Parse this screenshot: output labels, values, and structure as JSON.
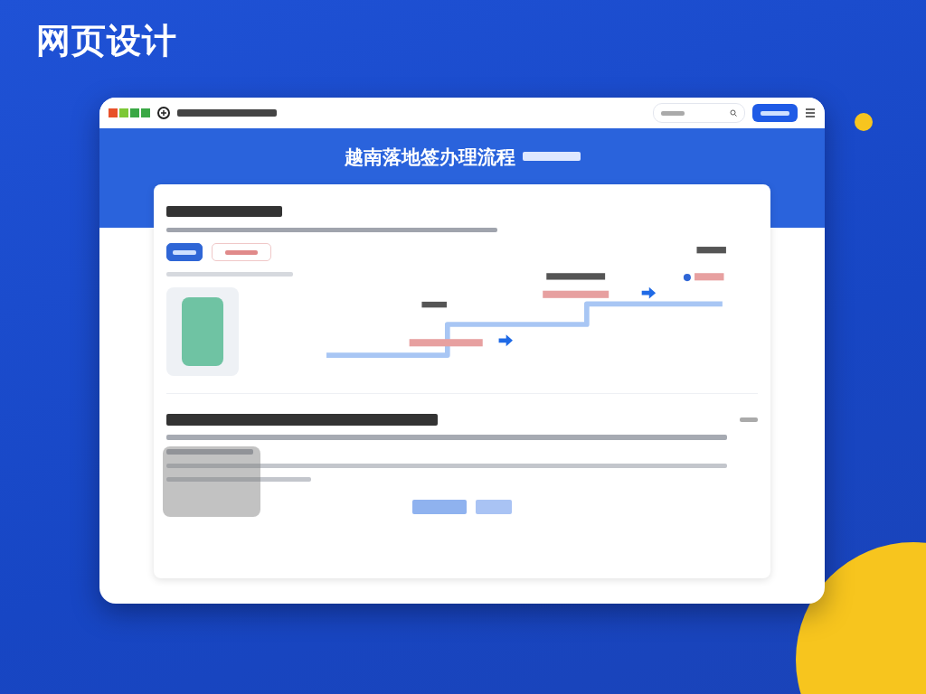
{
  "page_title": "网页设计",
  "window": {
    "hero_title": "越南落地签办理流程"
  }
}
